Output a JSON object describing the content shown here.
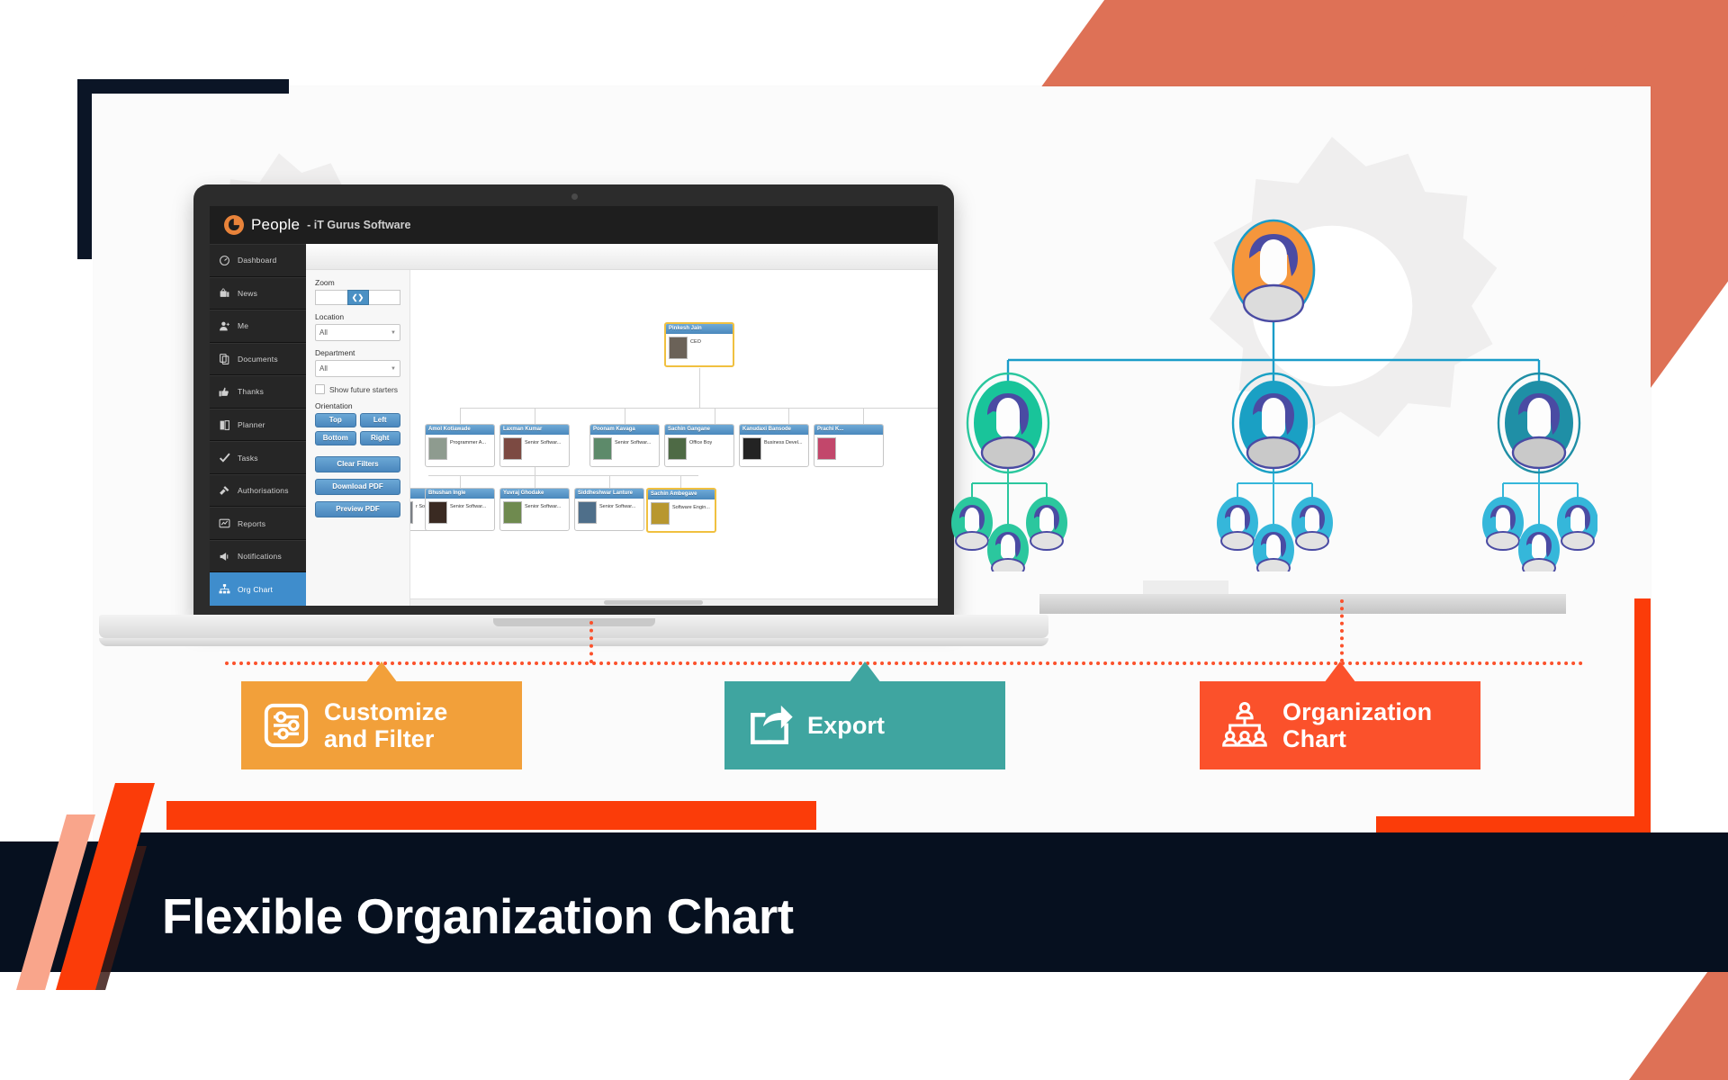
{
  "page": {
    "title": "Flexible Organization Chart"
  },
  "app": {
    "brand": "People",
    "subtitle": "- iT Gurus Software",
    "logo_icon": "people-logo-icon",
    "sidebar": [
      {
        "label": "Dashboard",
        "icon": "dashboard-icon",
        "active": false
      },
      {
        "label": "News",
        "icon": "news-tv-icon",
        "active": false
      },
      {
        "label": "Me",
        "icon": "person-icon",
        "active": false
      },
      {
        "label": "Documents",
        "icon": "documents-icon",
        "active": false
      },
      {
        "label": "Thanks",
        "icon": "thumbs-up-icon",
        "active": false
      },
      {
        "label": "Planner",
        "icon": "planner-book-icon",
        "active": false
      },
      {
        "label": "Tasks",
        "icon": "check-icon",
        "active": false
      },
      {
        "label": "Authorisations",
        "icon": "gavel-icon",
        "active": false
      },
      {
        "label": "Reports",
        "icon": "report-chart-icon",
        "active": false
      },
      {
        "label": "Notifications",
        "icon": "megaphone-icon",
        "active": false
      },
      {
        "label": "Org Chart",
        "icon": "org-chart-icon",
        "active": true
      }
    ],
    "filters": {
      "zoom_label": "Zoom",
      "zoom_handle_icon": "resize-horizontal-icon",
      "location_label": "Location",
      "location_value": "All",
      "department_label": "Department",
      "department_value": "All",
      "show_future_starters_label": "Show future starters",
      "show_future_starters_checked": false,
      "orientation_label": "Orientation",
      "orientation_buttons": [
        "Top",
        "Left",
        "Bottom",
        "Right"
      ],
      "clear_filters_label": "Clear Filters",
      "download_pdf_label": "Download PDF",
      "preview_pdf_label": "Preview PDF"
    }
  },
  "chart_data": {
    "type": "org-chart",
    "title": "Org Chart",
    "root": {
      "name": "Pinkesh Jain",
      "role": "CEO",
      "selected": true
    },
    "level2": [
      {
        "name": "Amol Kotiawade",
        "role": "Programmer A..."
      },
      {
        "name": "Laxman Kumar",
        "role": "Senior Softwar..."
      },
      {
        "name": "Poonam Kavaga",
        "role": "Senior Softwar..."
      },
      {
        "name": "Sachin Gangane",
        "role": "Office Boy"
      },
      {
        "name": "Kanudaxi Bansode",
        "role": "Business Devel..."
      },
      {
        "name": "Prachi K...",
        "role": ""
      }
    ],
    "level3": [
      {
        "name": "",
        "role": "r Softwar...",
        "partial": true
      },
      {
        "name": "Bhushan Ingle",
        "role": "Senior Softwar..."
      },
      {
        "name": "Yuvraj Ghodake",
        "role": "Senior Softwar..."
      },
      {
        "name": "Siddheshwar Lanture",
        "role": "Senior Softwar..."
      },
      {
        "name": "Sachin Ambegave",
        "role": "Software Engin...",
        "selected": true
      }
    ]
  },
  "illustration": {
    "name": "org-chart-illustration",
    "root_color": "#f5963c",
    "branch_colors": [
      "#19c49a",
      "#1aa0c4",
      "#1f8fa6"
    ],
    "line_color": "#1a9cc9",
    "nodes": {
      "root": 1,
      "managers": 3,
      "reports_per_manager": 3
    }
  },
  "callouts": [
    {
      "icon": "sliders-filter-icon",
      "line1": "Customize",
      "line2": "and Filter",
      "color": "#f2a03a"
    },
    {
      "icon": "export-share-icon",
      "line1": "Export",
      "line2": "",
      "color": "#3fa5a0"
    },
    {
      "icon": "org-chart-icon",
      "line1": "Organization",
      "line2": "Chart",
      "color": "#fb512b"
    }
  ],
  "colors": {
    "navy": "#06101f",
    "orange_red": "#fb3c09",
    "salmon": "#de7156",
    "teal": "#3fa5a0",
    "amber": "#f2a03a",
    "app_blue": "#3f8dcc"
  }
}
